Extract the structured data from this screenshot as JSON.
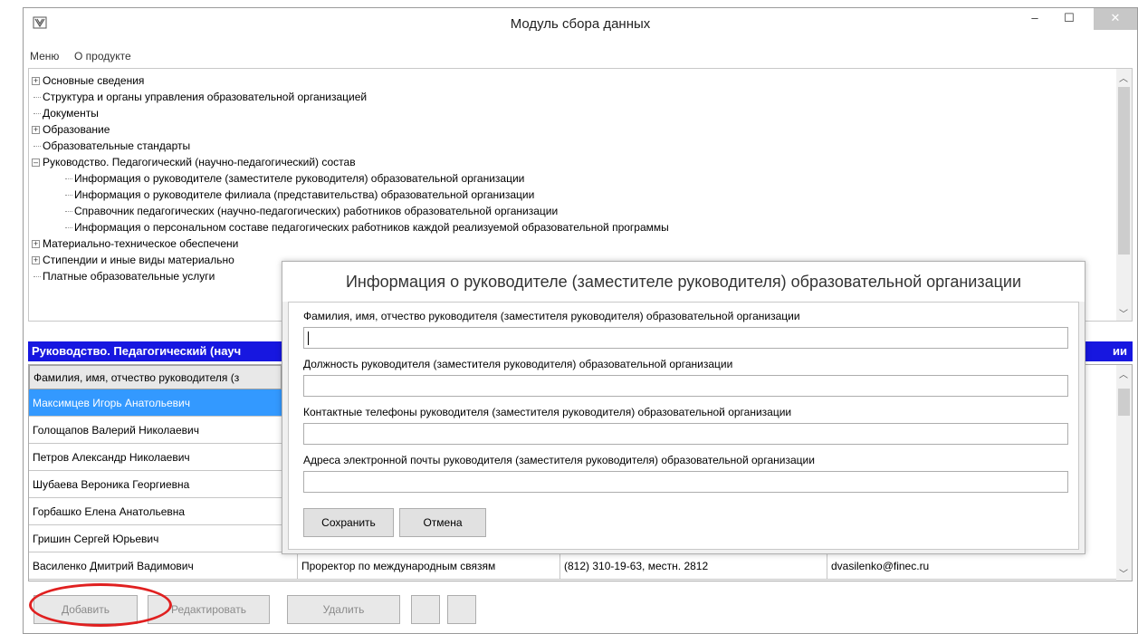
{
  "window": {
    "title": "Модуль сбора данных",
    "minimize_glyph": "–",
    "maximize_glyph": "☐",
    "close_glyph": "✕",
    "app_icon": "leaf-icon"
  },
  "menu": {
    "items": [
      "Меню",
      "О продукте"
    ]
  },
  "tree": {
    "nodes": [
      {
        "label": "Основные сведения",
        "expander": "+"
      },
      {
        "label": "Структура и органы управления образовательной организацией"
      },
      {
        "label": "Документы"
      },
      {
        "label": "Образование",
        "expander": "+"
      },
      {
        "label": "Образовательные стандарты"
      },
      {
        "label": "Руководство. Педагогический (научно-педагогический) состав",
        "expander": "–"
      },
      {
        "label": "Информация о руководителе (заместителе руководителя) образовательной организации"
      },
      {
        "label": "Информация о руководителе филиала (представительства) образовательной организации"
      },
      {
        "label": "Справочник педагогических (научно-педагогических) работников образовательной организации"
      },
      {
        "label": "Информация о персональном составе педагогических работников каждой реализуемой образовательной программы"
      },
      {
        "label": "Материально-техническое обеспечени",
        "expander": "+"
      },
      {
        "label": "Стипендии и иные виды материально",
        "expander": "+"
      },
      {
        "label": "Платные образовательные услуги"
      }
    ]
  },
  "panel": {
    "title": "Руководство. Педагогический (науч",
    "title_end": "ии",
    "column_header": "Фамилия, имя, отчество руководителя (з",
    "rows": [
      {
        "name": "Максимцев Игорь Анатольевич",
        "position": "",
        "phone": "",
        "email": ""
      },
      {
        "name": "Голощапов Валерий Николаевич",
        "position": "",
        "phone": "",
        "email": ""
      },
      {
        "name": "Петров Александр Николаевич",
        "position": "",
        "phone": "",
        "email": ""
      },
      {
        "name": "Шубаева Вероника Георгиевна",
        "position": "",
        "phone": "",
        "email": ""
      },
      {
        "name": "Горбашко Елена Анатольевна",
        "position": "",
        "phone": "",
        "email": ""
      },
      {
        "name": "Гришин Сергей Юрьевич",
        "position": "",
        "phone": "",
        "email": ""
      },
      {
        "name": "Василенко Дмитрий Вадимович",
        "position": "Проректор по международным связям",
        "phone": "(812) 310-19-63, местн. 2812",
        "email": "dvasilenko@finec.ru"
      }
    ]
  },
  "buttons": {
    "add": "Добавить",
    "edit": "Редактировать",
    "delete": "Удалить"
  },
  "dialog": {
    "title": "Информация о руководителе (заместителе руководителя) образовательной организации",
    "fields": [
      {
        "label": "Фамилия, имя, отчество руководителя (заместителя руководителя) образовательной организации",
        "value": ""
      },
      {
        "label": "Должность руководителя (заместителя руководителя) образовательной организации",
        "value": ""
      },
      {
        "label": "Контактные телефоны руководителя (заместителя руководителя) образовательной организации",
        "value": ""
      },
      {
        "label": "Адреса электронной почты руководителя (заместителя руководителя) образовательной организации",
        "value": ""
      }
    ],
    "save": "Сохранить",
    "cancel": "Отмена"
  },
  "colors": {
    "selection": "#3399ff",
    "panel_header": "#1717e0",
    "highlight_oval": "#e02020"
  }
}
